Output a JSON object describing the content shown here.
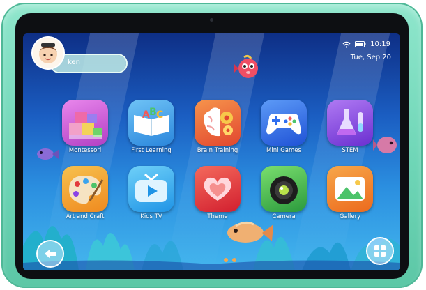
{
  "profile": {
    "username": "ken",
    "avatar_icon": "child-avatar-icon"
  },
  "status_bar": {
    "time": "10:19",
    "date": "Tue, Sep 20",
    "icons": [
      "wifi-icon",
      "battery-icon"
    ]
  },
  "apps": [
    {
      "label": "Montessori",
      "icon": "building-blocks-icon",
      "color": "#d65ad9"
    },
    {
      "label": "First Learning",
      "icon": "abc-book-icon",
      "color": "#3fa3ee"
    },
    {
      "label": "Brain Training",
      "icon": "brain-gears-icon",
      "color": "#f26a3c"
    },
    {
      "label": "Mini Games",
      "icon": "gamepad-icon",
      "color": "#2d6df0"
    },
    {
      "label": "STEM",
      "icon": "flask-icon",
      "color": "#8a43e6"
    },
    {
      "label": "Art and Craft",
      "icon": "paint-palette-icon",
      "color": "#f3a327"
    },
    {
      "label": "Kids TV",
      "icon": "tv-play-icon",
      "color": "#31a9f2"
    },
    {
      "label": "Theme",
      "icon": "theme-hearts-icon",
      "color": "#e23a3c"
    },
    {
      "label": "Camera",
      "icon": "camera-lens-icon",
      "color": "#39b34a"
    },
    {
      "label": "Gallery",
      "icon": "gallery-image-icon",
      "color": "#f3812a"
    }
  ],
  "navigation": {
    "back_icon": "back-arrow-icon",
    "menu_icon": "app-grid-icon"
  },
  "page_dots": 2,
  "colors": {
    "bezel": "#0d0f12",
    "tablet_case": "#6fd6b7",
    "dot_active": "#f7a64c"
  }
}
